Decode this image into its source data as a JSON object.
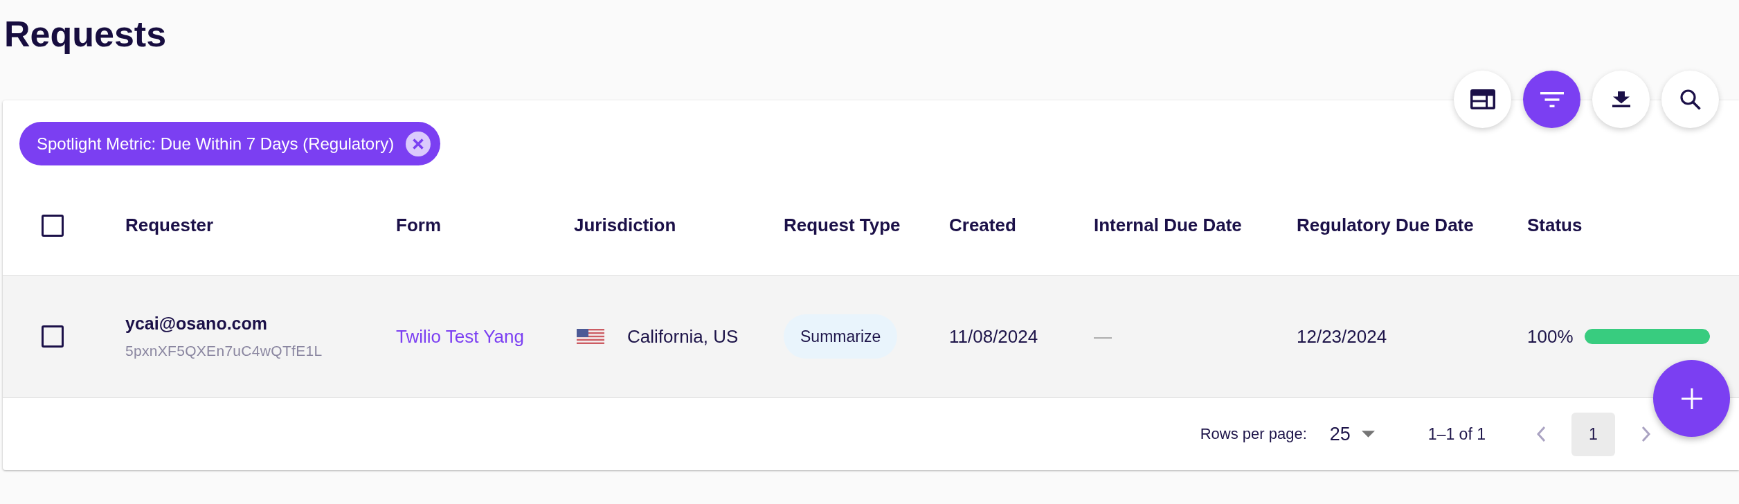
{
  "title": "Requests",
  "toolbar": [
    {
      "kind": "layout",
      "active": false
    },
    {
      "kind": "filter",
      "active": true
    },
    {
      "kind": "download",
      "active": false
    },
    {
      "kind": "search",
      "active": false
    }
  ],
  "filter_chips": [
    {
      "label": "Spotlight Metric: Due Within 7 Days (Regulatory)"
    }
  ],
  "table": {
    "select_all": {
      "checked": false
    },
    "columns": [
      "Requester",
      "Form",
      "Jurisdiction",
      "Request Type",
      "Created",
      "Internal Due Date",
      "Regulatory Due Date",
      "Status"
    ],
    "rows": [
      {
        "checked": false,
        "requester": {
          "email": "ycai@osano.com",
          "id": "5pxnXF5QXEn7uC4wQTfE1L"
        },
        "form": "Twilio Test Yang",
        "jurisdiction": "California, US",
        "request_type": "Summarize",
        "created": "11/08/2024",
        "internal_due_date": {
          "value": "—",
          "empty": true
        },
        "regulatory_due_date": "12/23/2024",
        "status": {
          "reading": "100%",
          "level": 1
        }
      }
    ]
  },
  "pagination": {
    "rows_per_page_label": "Rows per page:",
    "rows_per_page": "25",
    "range": "1–1 of 1",
    "previous": {
      "disabled": true
    },
    "pages": [
      {
        "label": "1",
        "selected": true
      }
    ],
    "next": {
      "disabled": true
    }
  }
}
